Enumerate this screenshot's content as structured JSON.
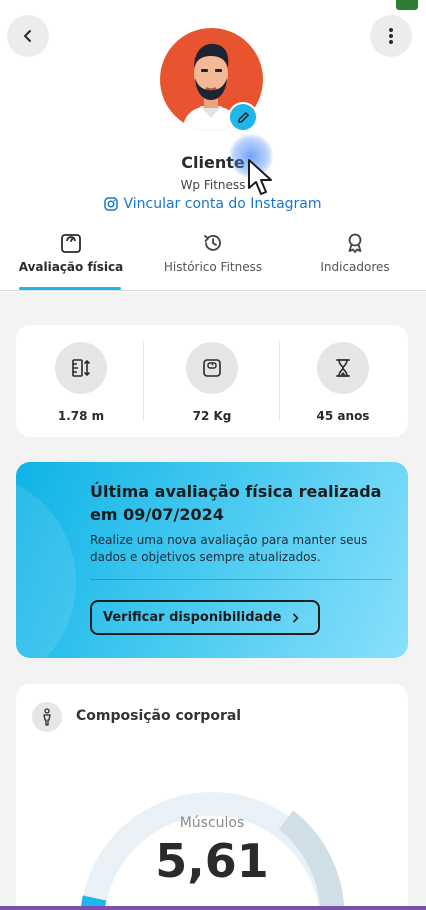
{
  "header": {
    "back_icon": "chevron-left-icon",
    "menu_icon": "more-vertical-icon",
    "avatar_bg": "#e8542f",
    "edit_icon": "pencil-icon",
    "name": "Cliente",
    "company": "Wp Fitness",
    "instagram_link": "Vincular conta do Instagram"
  },
  "tabs": [
    {
      "label": "Avaliação física",
      "icon": "scale-icon",
      "active": true
    },
    {
      "label": "Histórico Fitness",
      "icon": "history-icon",
      "active": false
    },
    {
      "label": "Indicadores",
      "icon": "award-icon",
      "active": false
    }
  ],
  "stats": [
    {
      "value": "1.78 m",
      "icon": "height-icon"
    },
    {
      "value": "72 Kg",
      "icon": "weight-scale-icon"
    },
    {
      "value": "45 anos",
      "icon": "hourglass-icon"
    }
  ],
  "promo": {
    "title": "Última avaliação física realizada em  09/07/2024",
    "text": "Realize uma nova avaliação para manter seus dados e objetivos sempre atualizados.",
    "button": "Verificar disponibilidade",
    "button_icon": "chevron-right-icon"
  },
  "composition": {
    "title": "Composição corporal",
    "icon": "body-icon",
    "gauge_label": "Músculos",
    "gauge_value": "5,61"
  },
  "colors": {
    "accent": "#1fb6ea",
    "link": "#1877c9",
    "page_bg": "#f3f3f3"
  }
}
